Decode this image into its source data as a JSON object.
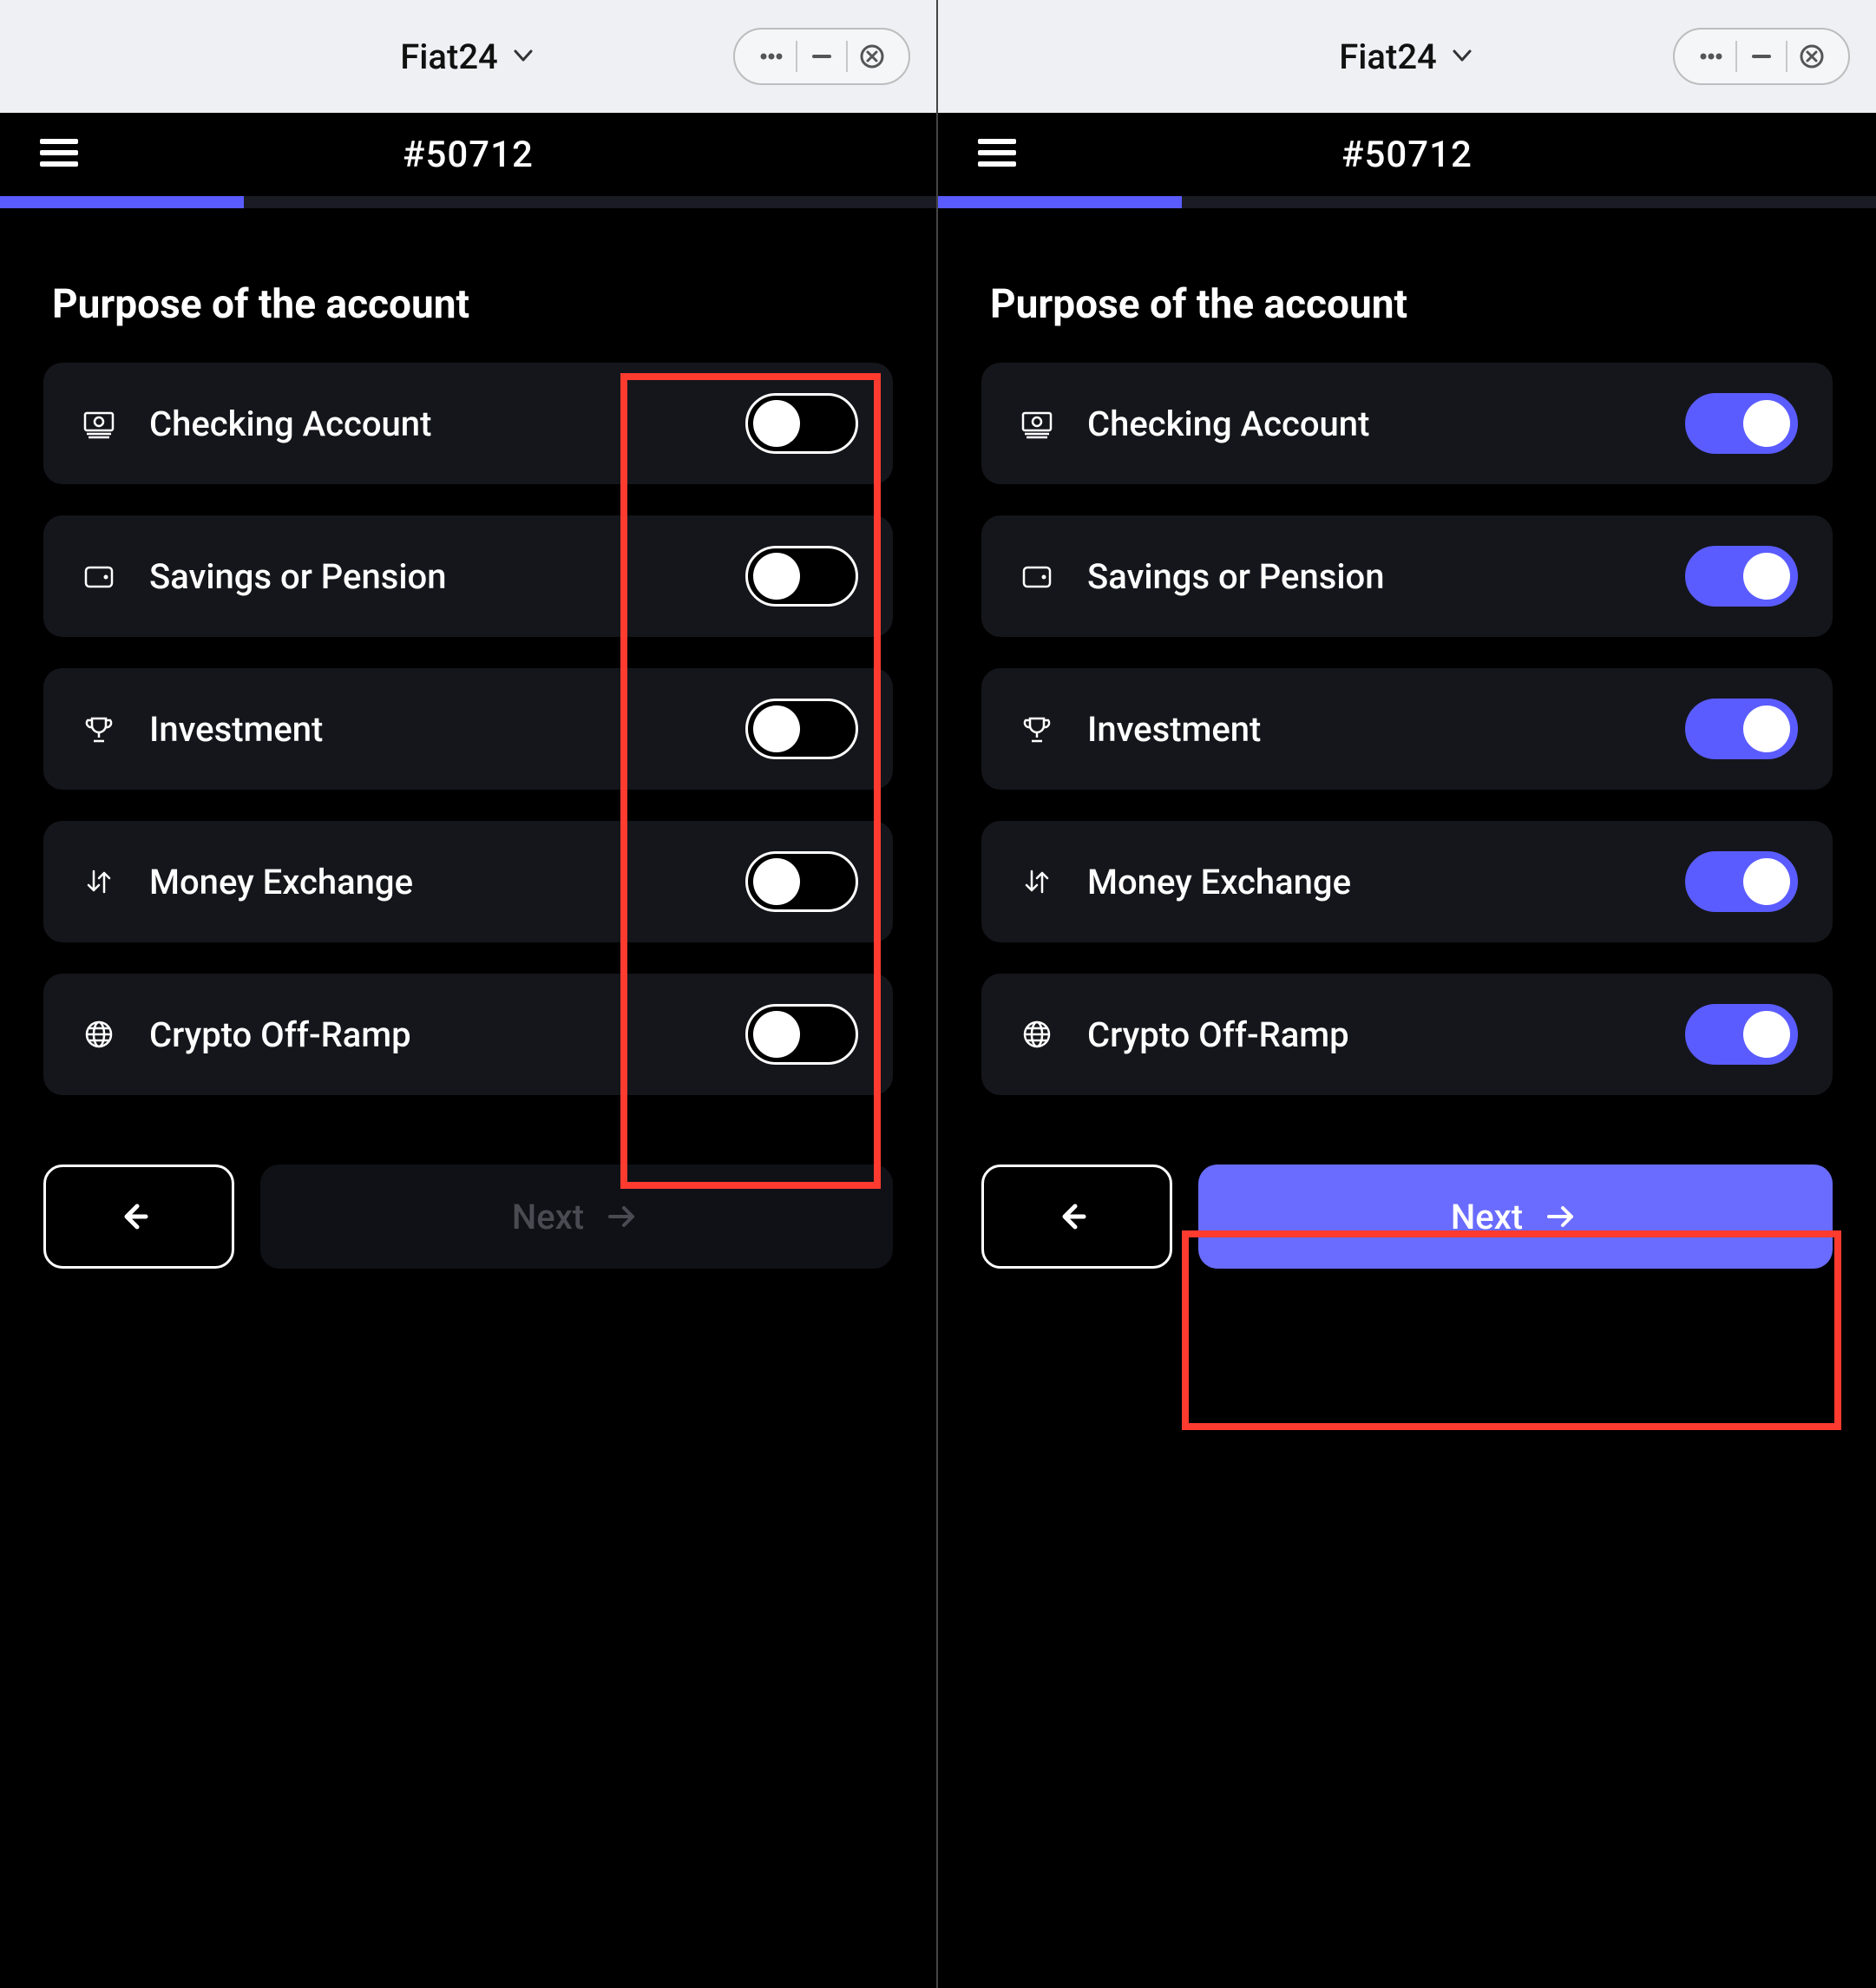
{
  "left": {
    "mini_title": "Fiat24",
    "account_id": "#50712",
    "progress_percent": 26,
    "section_title": "Purpose of the account",
    "options": [
      {
        "icon": "cash-icon",
        "label": "Checking Account",
        "on": false
      },
      {
        "icon": "wallet-icon",
        "label": "Savings or Pension",
        "on": false
      },
      {
        "icon": "trophy-icon",
        "label": "Investment",
        "on": false
      },
      {
        "icon": "exchange-icon",
        "label": "Money Exchange",
        "on": false
      },
      {
        "icon": "globe-icon",
        "label": "Crypto Off-Ramp",
        "on": false
      }
    ],
    "back_label": "Back",
    "next_label": "Next",
    "next_enabled": false,
    "highlight": "toggles"
  },
  "right": {
    "mini_title": "Fiat24",
    "account_id": "#50712",
    "progress_percent": 26,
    "section_title": "Purpose of the account",
    "options": [
      {
        "icon": "cash-icon",
        "label": "Checking Account",
        "on": true
      },
      {
        "icon": "wallet-icon",
        "label": "Savings or Pension",
        "on": true
      },
      {
        "icon": "trophy-icon",
        "label": "Investment",
        "on": true
      },
      {
        "icon": "exchange-icon",
        "label": "Money Exchange",
        "on": true
      },
      {
        "icon": "globe-icon",
        "label": "Crypto Off-Ramp",
        "on": true
      }
    ],
    "back_label": "Back",
    "next_label": "Next",
    "next_enabled": true,
    "highlight": "next"
  },
  "colors": {
    "accent": "#5b5cff",
    "accent_light": "#6a6cff",
    "row_bg": "#15161b",
    "highlight": "#ff3b30"
  }
}
